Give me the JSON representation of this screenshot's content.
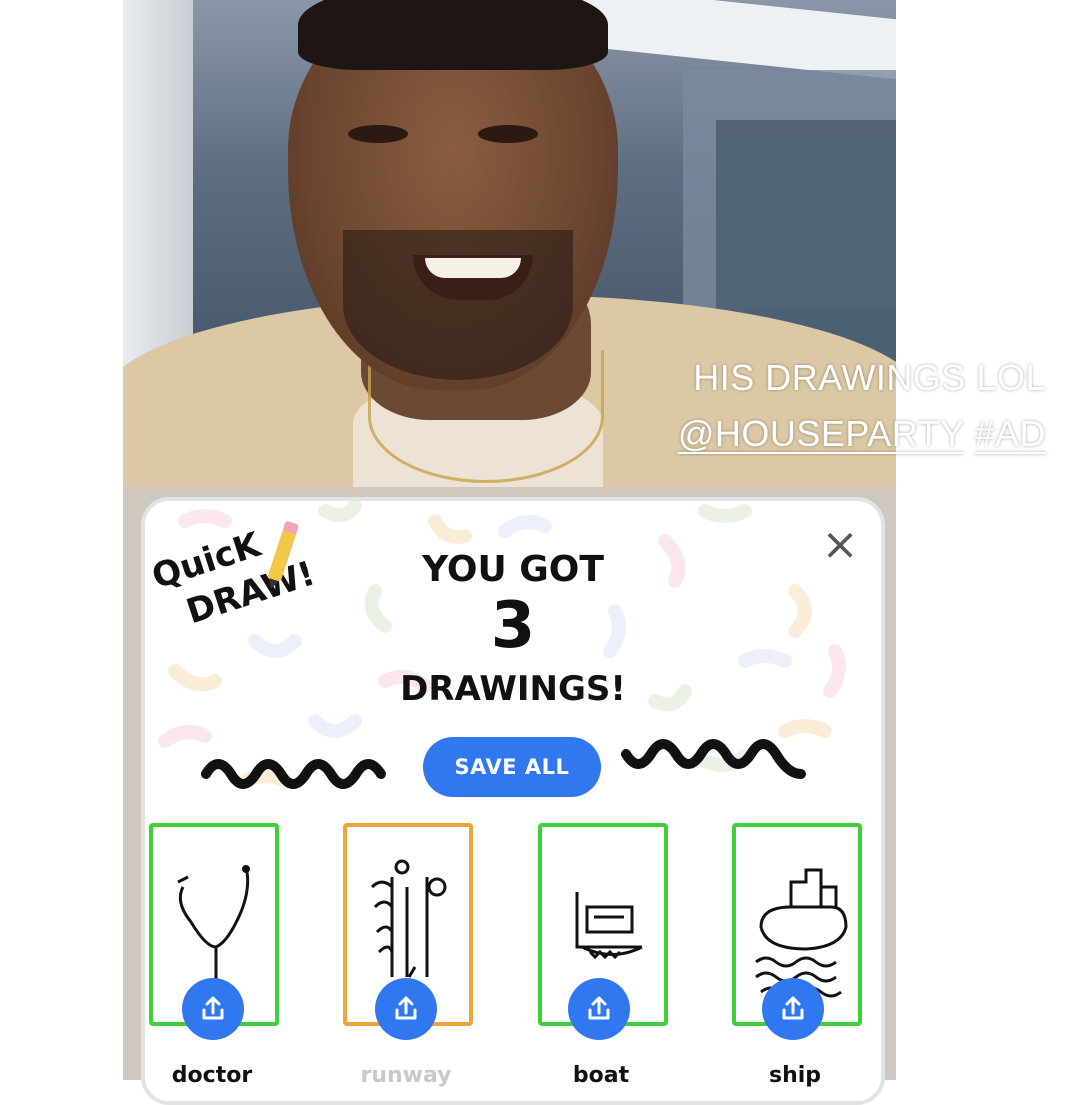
{
  "story": {
    "caption_line1": "HIS DRAWINGS LOL",
    "mention": "@HOUSEPARTY",
    "hashtag": "#AD"
  },
  "quickdraw": {
    "logo_line1": "QuicK",
    "logo_line2": "DRAW!",
    "close_icon": "×",
    "headline_top": "YOU GOT",
    "count": "3",
    "headline_bottom": "DRAWINGS!",
    "save_all_label": "SAVE ALL",
    "accent_color": "#2f78f0",
    "success_color": "#3fcf3a",
    "miss_color": "#f0a33a",
    "drawings": [
      {
        "label": "doctor",
        "status": "guessed"
      },
      {
        "label": "runway",
        "status": "missed"
      },
      {
        "label": "boat",
        "status": "guessed"
      },
      {
        "label": "ship",
        "status": "guessed"
      }
    ]
  }
}
